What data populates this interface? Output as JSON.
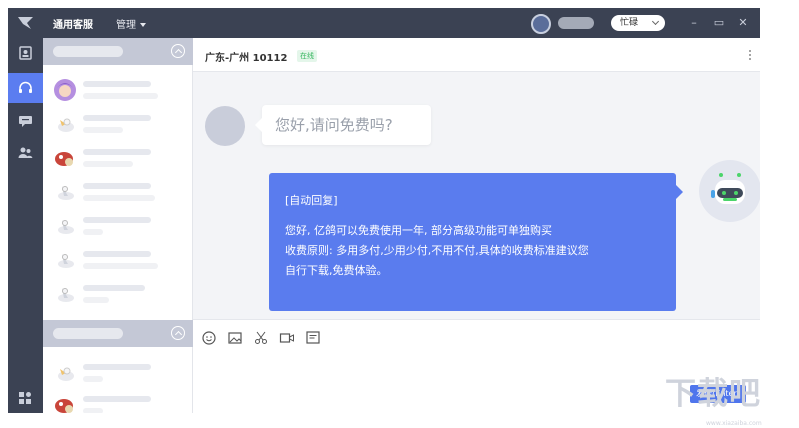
{
  "app": {
    "title": "通用客服",
    "manage_menu": "管理",
    "status": "忙碌",
    "window_controls": [
      "–",
      "▭",
      "✕"
    ]
  },
  "nav": [
    {
      "icon": "contacts-book-icon",
      "active": false
    },
    {
      "icon": "headset-icon",
      "active": true
    },
    {
      "icon": "chat-bubble-icon",
      "active": false
    },
    {
      "icon": "users-icon",
      "active": false
    },
    {
      "icon": "apps-grid-icon",
      "active": false
    }
  ],
  "chat": {
    "title": "广东-广州 10112",
    "online_badge": "在线",
    "visitor_message": "您好,请问免费吗?",
    "auto_reply_tag": "[自动回复]",
    "auto_reply_text": "您好, 亿鸽可以免费使用一年, 部分高级功能可单独购买\n收费原则: 多用多付,少用少付,不用不付,具体的收费标准建议您\n自行下载,免费体验。",
    "send_button": "发送(Enter)"
  },
  "toolbar": [
    "emoji-icon",
    "image-icon",
    "scissors-icon",
    "video-icon",
    "note-icon"
  ],
  "colors": {
    "sidebar": "#3b4253",
    "accent": "#5a7cee",
    "online": "#36b65f"
  },
  "watermark": {
    "text": "下载吧",
    "sub": "www.xiazaiba.com"
  }
}
